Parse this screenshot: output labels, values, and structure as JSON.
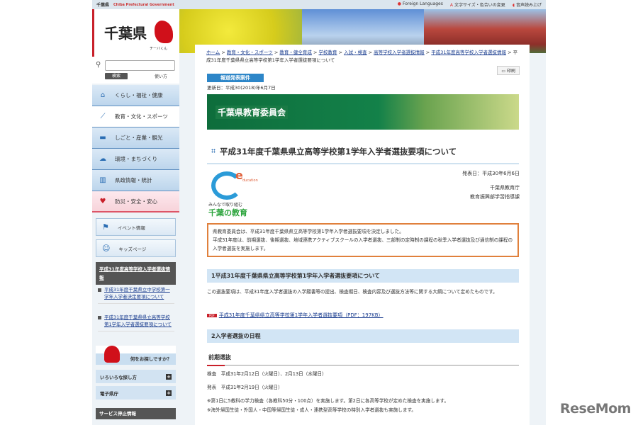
{
  "topbar": {
    "pref": "千葉県",
    "pref_en": "Chiba Prefectural Government",
    "foreign": "Foreign Languages",
    "textsize": "文字サイズ・色合いの変更",
    "speech": "音声読み上げ"
  },
  "logo": {
    "title": "千葉県",
    "mascot": "チーバくん"
  },
  "search": {
    "placeholder": "",
    "button": "検索",
    "help": "使い方"
  },
  "nav": [
    "くらし・福祉・健康",
    "教育・文化・スポーツ",
    "しごと・産業・観光",
    "環境・まちづくり",
    "県政情報・統計",
    "防災・安全・安心"
  ],
  "boxes": {
    "event": "イベント情報",
    "kids": "キッズページ"
  },
  "side": {
    "section_title": "平成31年度高等学校入学者選抜情報",
    "links": [
      "平成31年度千葉県立中学校第一学年入学者決定要項について",
      "平成31年度千葉県県立高等学校第1学年入学者選抜要項について"
    ],
    "ask": "何をお探しですか？",
    "acc1": "いろいろな探し方",
    "acc2": "電子県庁",
    "service": "サービス停止情報"
  },
  "breadcrumb": [
    "ホーム",
    "教育・文化・スポーツ",
    "教育・健全育成",
    "学校教育",
    "入試・検査",
    "高等学校入学者選抜情報",
    "平成31年度高等学校入学者選抜情報"
  ],
  "breadcrumb_current": "平成31年度千葉県県立高等学校第1学年入学者選抜要項について",
  "print": "印刷",
  "press": "報道発表案件",
  "updated": "更新日：平成30(2018)年6月7日",
  "banner_title": "千葉県教育委員会",
  "title": "平成31年度千葉県県立高等学校第1学年入学者選抜要項について",
  "edu_logo": {
    "e": "e",
    "education": "ducation",
    "slogan": "みんなで取り組む",
    "name": "千葉の教育"
  },
  "pub_date": "発表日：平成30年6月6日",
  "org1": "千葉県教育庁",
  "org2": "教育振興部学習指導課",
  "intro": [
    "県教育委員会は、平成31年度千葉県県立高等学校第1学年入学者選抜要項を決定しました。",
    "平成31年度は、前期選抜、後期選抜、地域連携アクティブスクールの入学者選抜、三部制の定時制の課程の秋季入学者選抜及び通信制の課程の入学者選抜を実施します。"
  ],
  "sec1": {
    "heading": "1平成31年度千葉県県立高等学校第1学年入学者選抜要項について",
    "text": "この選抜要項は、平成31年度入学者選抜の入学願書等の提出、検査期日、検査内容及び選抜方法等に関する大綱について定めたものです。",
    "pdf_badge": "PDF",
    "pdf_link": "平成31年度千葉県県立高等学校第1学年入学者選抜要項（PDF：197KB）"
  },
  "sec2": {
    "heading": "2入学者選抜の日程",
    "sub": "前期選抜",
    "exam": "検査　平成31年2月12日（火曜日）、2月13日（水曜日）",
    "announce": "発表　平成31年2月19日（火曜日）",
    "note1": "※第1日に5教科の学力検査（各教科50分・100点）を実施します。第2日に各高等学校が定めた検査を実施します。",
    "note2": "※海外帰国生徒・外国人・中国等帰国生徒・成人・連携型高等学校の特別入学者選抜も実施します。"
  },
  "watermark": "ReseMom"
}
